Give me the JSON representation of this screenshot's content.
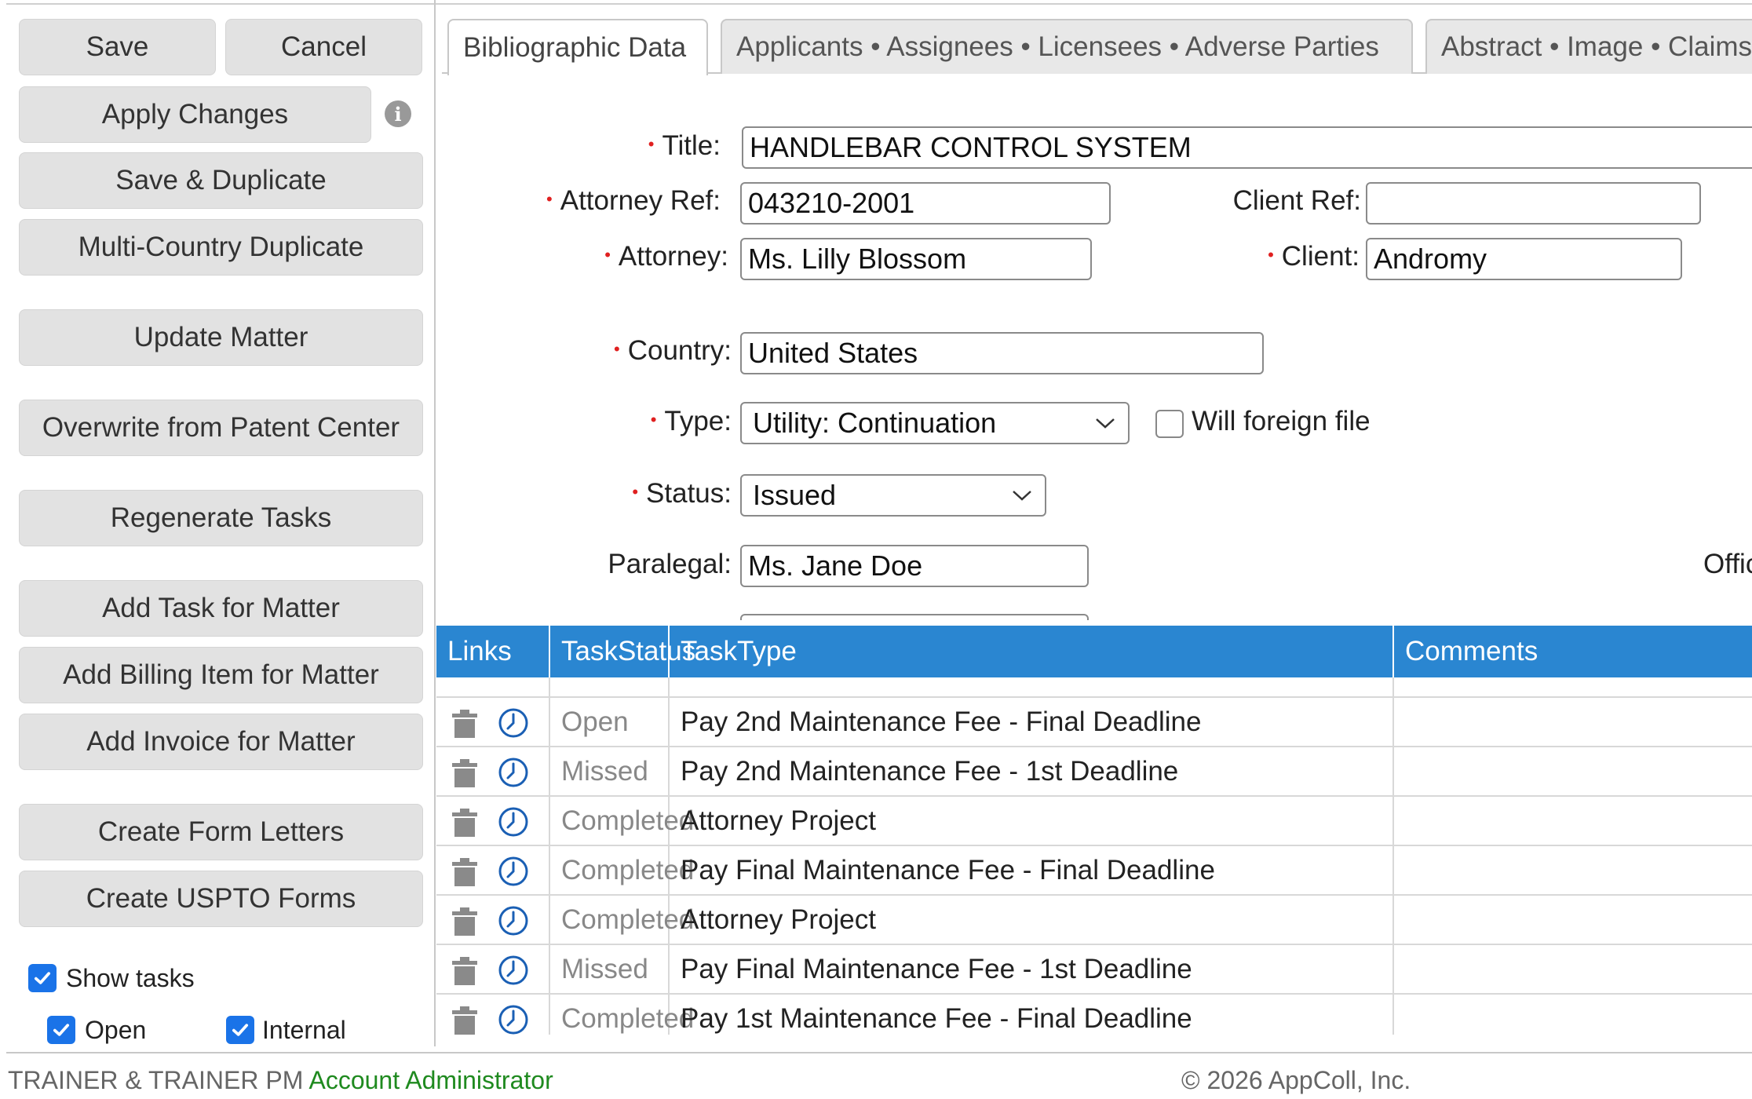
{
  "sidebar": {
    "save_label": "Save",
    "cancel_label": "Cancel",
    "apply_changes_label": "Apply Changes",
    "save_duplicate_label": "Save & Duplicate",
    "multi_country_label": "Multi-Country Duplicate",
    "update_matter_label": "Update Matter",
    "overwrite_label": "Overwrite from Patent Center",
    "regenerate_label": "Regenerate Tasks",
    "add_task_label": "Add Task for Matter",
    "add_billing_label": "Add Billing Item for Matter",
    "add_invoice_label": "Add Invoice for Matter",
    "form_letters_label": "Create Form Letters",
    "uspto_forms_label": "Create USPTO Forms",
    "show_tasks_label": "Show tasks",
    "open_label": "Open",
    "internal_label": "Internal"
  },
  "tabs": [
    {
      "label": "Bibliographic Data"
    },
    {
      "label": "Applicants • Assignees • Licensees • Adverse Parties"
    },
    {
      "label": "Abstract • Image • Claims"
    }
  ],
  "form": {
    "title_label": "Title:",
    "title_value": "HANDLEBAR CONTROL SYSTEM",
    "attorney_ref_label": "Attorney Ref:",
    "attorney_ref_value": "043210-2001",
    "client_ref_label": "Client Ref:",
    "client_ref_value": "",
    "attorney_label": "Attorney:",
    "attorney_value": "Ms. Lilly Blossom",
    "client_label": "Client:",
    "client_value": "Andromy",
    "country_label": "Country:",
    "country_value": "United States",
    "type_label": "Type:",
    "type_value": "Utility: Continuation",
    "will_foreign_label": "Will foreign file",
    "status_label": "Status:",
    "status_value": "Issued",
    "paralegal_label": "Paralegal:",
    "paralegal_value": "Ms. Jane Doe",
    "office_label_partial": "Offic"
  },
  "tasks": {
    "columns": [
      "Links",
      "TaskStatus",
      "TaskType",
      "Comments"
    ],
    "rows": [
      {
        "status": "Open",
        "type": "Pay 2nd Maintenance Fee - Final Deadline",
        "comments": ""
      },
      {
        "status": "Missed",
        "type": "Pay 2nd Maintenance Fee - 1st Deadline",
        "comments": ""
      },
      {
        "status": "Completed",
        "type": "Attorney Project",
        "comments": ""
      },
      {
        "status": "Completed",
        "type": "Pay Final Maintenance Fee - Final Deadline",
        "comments": ""
      },
      {
        "status": "Completed",
        "type": "Attorney Project",
        "comments": ""
      },
      {
        "status": "Missed",
        "type": "Pay Final Maintenance Fee - 1st Deadline",
        "comments": ""
      },
      {
        "status": "Completed",
        "type": "Pay 1st Maintenance Fee - Final Deadline",
        "comments": ""
      }
    ]
  },
  "footer": {
    "firm": "TRAINER & TRAINER  PM",
    "role": "Account Administrator",
    "copyright": "© 2026 AppColl, Inc."
  },
  "colors": {
    "accent": "#2a86d1",
    "checkbox": "#1a73e8",
    "required": "#e02020",
    "role": "#1f8a1f"
  }
}
